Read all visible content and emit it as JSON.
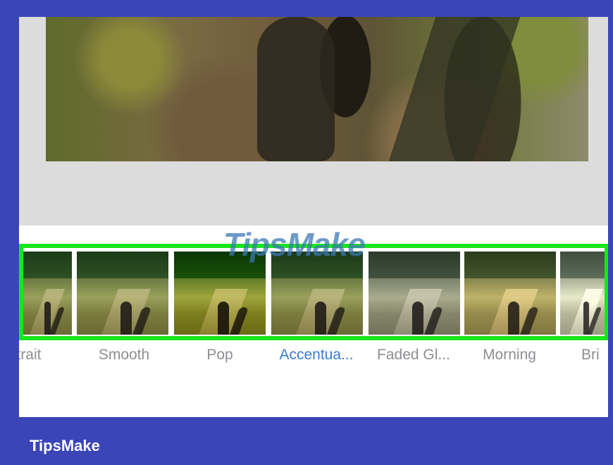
{
  "filters": [
    {
      "name": "trait",
      "active": false
    },
    {
      "name": "Smooth",
      "active": false
    },
    {
      "name": "Pop",
      "active": false
    },
    {
      "name": "Accentua...",
      "active": true
    },
    {
      "name": "Faded Gl...",
      "active": false
    },
    {
      "name": "Morning",
      "active": false
    },
    {
      "name": "Bri",
      "active": false
    }
  ],
  "watermark": "TipsMake",
  "brand": "TipsMake",
  "colors": {
    "frame": "#3b45b8",
    "highlight": "#19e619",
    "active_label": "#3a7bd5",
    "inactive_label": "#8e8e93"
  }
}
